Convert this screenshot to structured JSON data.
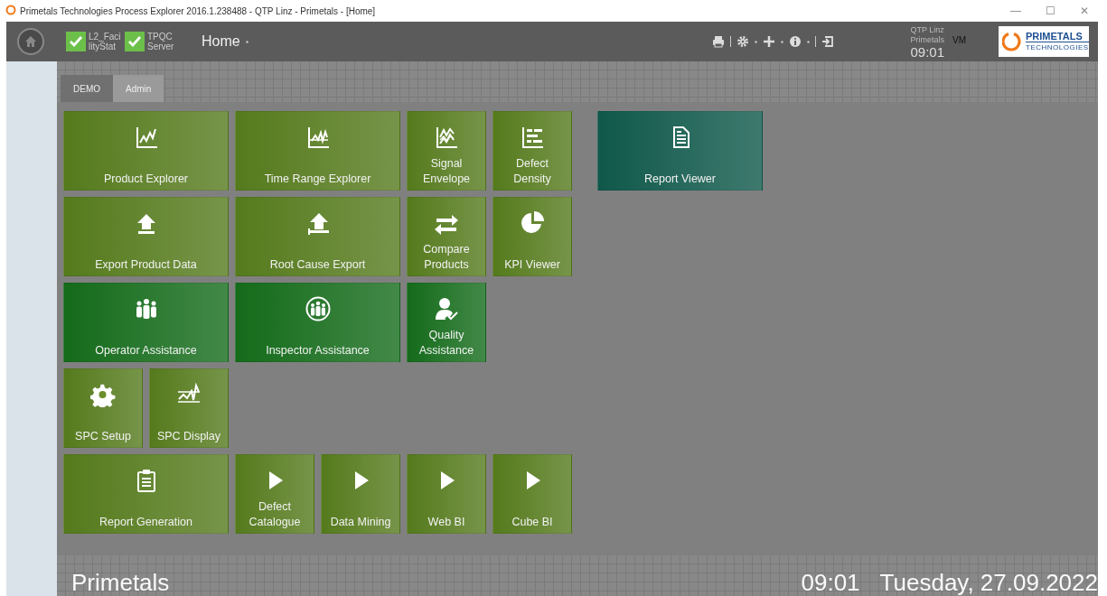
{
  "window": {
    "title": "Primetals Technologies Process Explorer 2016.1.238488 - QTP Linz - Primetals - [Home]",
    "controls": [
      "—",
      "☐",
      "✕"
    ]
  },
  "header": {
    "status_checks": [
      {
        "label_lines": [
          "L2_Faci",
          "lityStat"
        ],
        "checked": true
      },
      {
        "label_lines": [
          "TPQC",
          "Server"
        ],
        "checked": true
      }
    ],
    "menu": "Home",
    "user": {
      "site": "QTP Linz",
      "company": "Primetals",
      "initials": "VM",
      "time": "09:01"
    },
    "logo": {
      "name": "PRIMETALS",
      "sub": "TECHNOLOGIES"
    }
  },
  "tabs": [
    {
      "label": "DEMO",
      "selected": false
    },
    {
      "label": "Admin",
      "selected": true
    }
  ],
  "tile_rows": [
    [
      {
        "label": "Product Explorer",
        "kind": "wide",
        "color": "#557a1c"
      },
      {
        "label": "Time Range Explorer",
        "kind": "wide",
        "color": "#557a1c"
      },
      {
        "label": "Signal Envelope",
        "kind": "square",
        "color": "#557a1c"
      },
      {
        "label": "Defect Density",
        "kind": "square",
        "color": "#557a1c"
      }
    ],
    [
      {
        "label": "Export Product Data",
        "kind": "wide",
        "color": "#557a1c"
      },
      {
        "label": "Root Cause Export",
        "kind": "wide",
        "color": "#557a1c"
      },
      {
        "label": "Compare Products",
        "kind": "square",
        "color": "#557a1c"
      },
      {
        "label": "KPI Viewer",
        "kind": "square",
        "color": "#557a1c"
      }
    ],
    [
      {
        "label": "Operator Assistance",
        "kind": "wide",
        "color": "#146b1a"
      },
      {
        "label": "Inspector Assistance",
        "kind": "wide",
        "color": "#146b1a"
      },
      {
        "label": "Quality Assistance",
        "kind": "square",
        "color": "#146b1a"
      }
    ],
    [
      {
        "label": "SPC Setup",
        "kind": "square",
        "color": "#557a1c"
      },
      {
        "label": "SPC Display",
        "kind": "square",
        "color": "#557a1c"
      }
    ],
    [
      {
        "label": "Report Generation",
        "kind": "wide",
        "color": "#557a1c"
      },
      {
        "label": "Defect Catalogue",
        "kind": "square",
        "color": "#557a1c"
      },
      {
        "label": "Data Mining",
        "kind": "square",
        "color": "#557a1c"
      },
      {
        "label": "Web BI",
        "kind": "square",
        "color": "#557a1c"
      },
      {
        "label": "Cube BI",
        "kind": "square",
        "color": "#557a1c"
      }
    ]
  ],
  "side_tiles": [
    {
      "label": "Report Viewer",
      "kind": "wide",
      "color": "#0f584a"
    }
  ],
  "footer": {
    "company": "Primetals",
    "time": "09:01",
    "date": "Tuesday, 27.09.2022"
  }
}
